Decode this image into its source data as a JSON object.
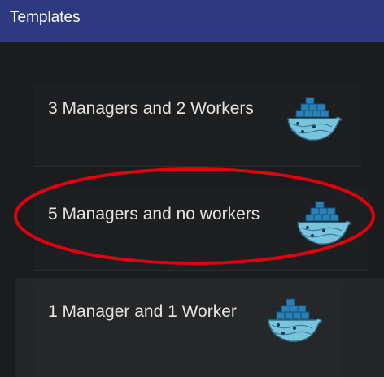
{
  "header": {
    "title": "Templates"
  },
  "templates": [
    {
      "label": "3 Managers and 2 Workers",
      "icon": "docker-whale-icon"
    },
    {
      "label": "5 Managers and no workers",
      "icon": "docker-whale-icon"
    },
    {
      "label": "1 Manager and 1 Worker",
      "icon": "docker-whale-icon"
    }
  ],
  "colors": {
    "header_bg": "#2e3a80",
    "page_bg": "#1b1c1e",
    "highlight": "#e0000f",
    "whale_blue": "#7ac3dd",
    "container_blue": "#2a7fb5"
  }
}
